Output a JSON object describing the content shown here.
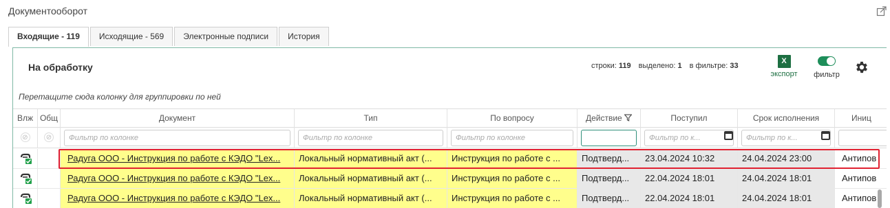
{
  "panel": {
    "title": "Документооборот",
    "popout_icon": "popout-icon"
  },
  "tabs": [
    {
      "label": "Входящие - 119",
      "active": true
    },
    {
      "label": "Исходящие - 569",
      "active": false
    },
    {
      "label": "Электронные подписи",
      "active": false
    },
    {
      "label": "История",
      "active": false
    }
  ],
  "section": {
    "title": "На обработку"
  },
  "stats": {
    "rows_label": "строки:",
    "rows_value": "119",
    "selected_label": "выделено:",
    "selected_value": "1",
    "filtered_label": "в фильтре:",
    "filtered_value": "33"
  },
  "toolbar": {
    "export_icon_text": "X",
    "export_label": "экспорт",
    "filter_label": "фильтр",
    "filter_on": true,
    "settings_icon": "gear-icon"
  },
  "group_hint": "Перетащите сюда колонку для группировки по ней",
  "columns": [
    {
      "label": "Влж"
    },
    {
      "label": "Общ"
    },
    {
      "label": "Документ"
    },
    {
      "label": "Тип"
    },
    {
      "label": "По вопросу"
    },
    {
      "label": "Действие"
    },
    {
      "label": "Поступил"
    },
    {
      "label": "Срок исполнения"
    },
    {
      "label": "Иниц"
    }
  ],
  "filter_placeholders": {
    "default": "Фильтр по колонке",
    "date": "Фильтр по к..."
  },
  "rows": [
    {
      "document": "Радуга ООО - Инструкция по работе с КЭДО \"Lex...",
      "type": "Локальный нормативный акт (...",
      "topic": "Инструкция по работе с ...",
      "action": "Подтверд...",
      "received": "23.04.2024 10:32",
      "deadline": "24.04.2024 23:00",
      "initiator": "Антипов"
    },
    {
      "document": "Радуга ООО - Инструкция по работе с КЭДО \"Lex...",
      "type": "Локальный нормативный акт (...",
      "topic": "Инструкция по работе с ...",
      "action": "Подтверд...",
      "received": "22.04.2024 18:01",
      "deadline": "24.04.2024 18:01",
      "initiator": "Антипов"
    },
    {
      "document": "Радуга ООО - Инструкция по работе с КЭДО \"Lex...",
      "type": "Локальный нормативный акт (...",
      "topic": "Инструкция по работе с ...",
      "action": "Подтверд...",
      "received": "22.04.2024 18:01",
      "deadline": "24.04.2024 18:01",
      "initiator": "Антипов"
    }
  ],
  "colors": {
    "accent": "#2f8f7a",
    "excel": "#1d6f42",
    "highlight": "#e02030",
    "row_yellow": "#fffe8c",
    "row_grey": "#e8e8e8"
  }
}
